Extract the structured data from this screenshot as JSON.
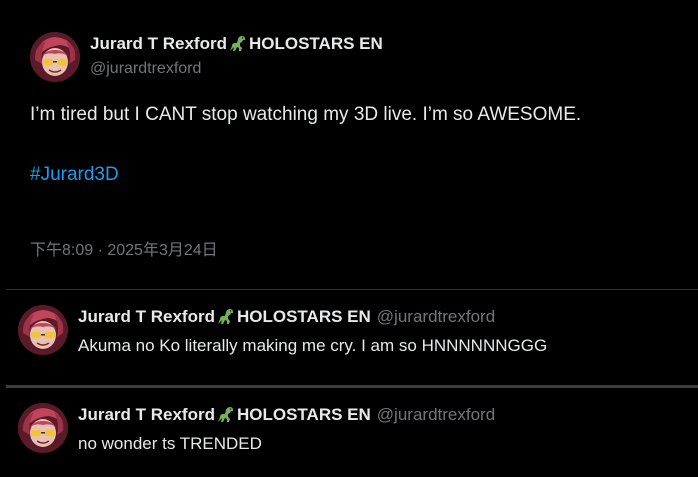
{
  "main_tweet": {
    "display_name_prefix": "Jurard T Rexford",
    "display_name_suffix": "HOLOSTARS EN",
    "name_icon": "dinosaur-emoji-icon",
    "handle": "@jurardtrexford",
    "text": "I’m tired but I CANT stop watching my 3D live. I’m so AWESOME.",
    "hashtag": "#Jurard3D",
    "timestamp": "下午8:09 · 2025年3月24日"
  },
  "replies": [
    {
      "display_name_prefix": "Jurard T Rexford",
      "display_name_suffix": "HOLOSTARS EN",
      "handle": "@jurardtrexford",
      "text": "Akuma no Ko literally making me cry. I am so HNNNNNNGGG"
    },
    {
      "display_name_prefix": "Jurard T Rexford",
      "display_name_suffix": "HOLOSTARS EN",
      "handle": "@jurardtrexford",
      "text": "no wonder ts TRENDED"
    }
  ],
  "colors": {
    "background": "#000000",
    "text_primary": "#e7e9ea",
    "text_secondary": "#71767b",
    "link": "#1d9bf0",
    "divider": "#2f3336"
  }
}
